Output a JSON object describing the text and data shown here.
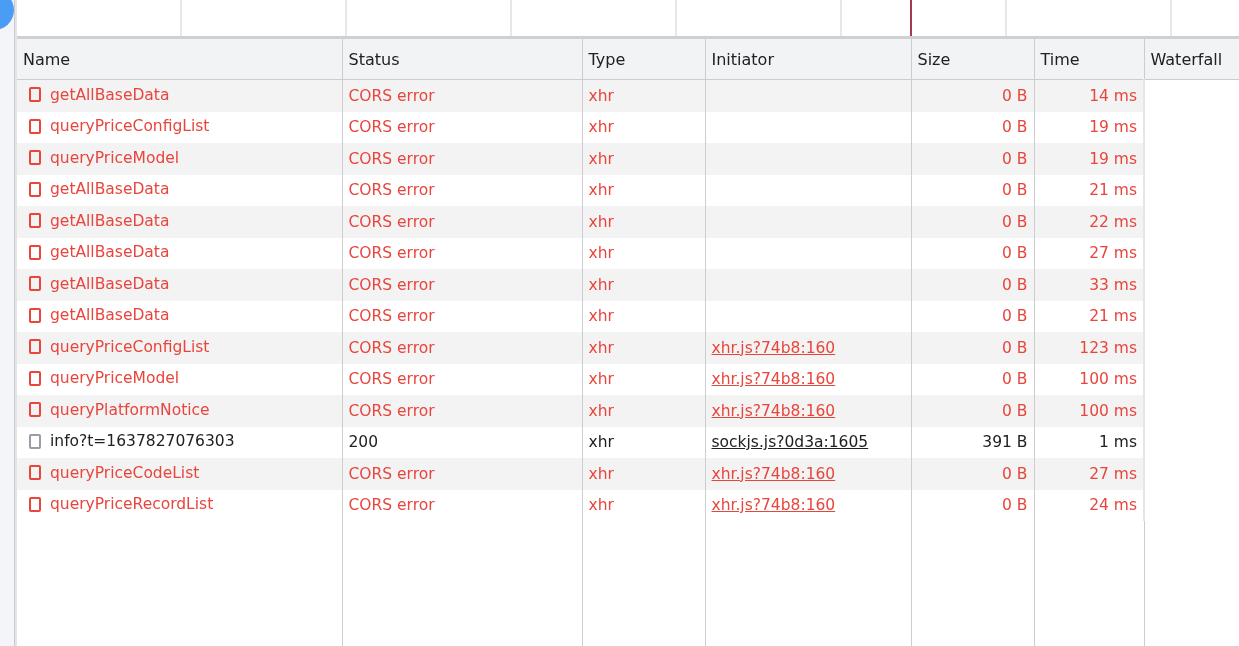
{
  "table": {
    "columns": [
      "Name",
      "Status",
      "Type",
      "Initiator",
      "Size",
      "Time",
      "Waterfall"
    ],
    "rows": [
      {
        "name": "getAllBaseData",
        "status": "CORS error",
        "type": "xhr",
        "initiator": "",
        "size": "0 B",
        "time": "14 ms",
        "error": true
      },
      {
        "name": "queryPriceConfigList",
        "status": "CORS error",
        "type": "xhr",
        "initiator": "",
        "size": "0 B",
        "time": "19 ms",
        "error": true
      },
      {
        "name": "queryPriceModel",
        "status": "CORS error",
        "type": "xhr",
        "initiator": "",
        "size": "0 B",
        "time": "19 ms",
        "error": true
      },
      {
        "name": "getAllBaseData",
        "status": "CORS error",
        "type": "xhr",
        "initiator": "",
        "size": "0 B",
        "time": "21 ms",
        "error": true
      },
      {
        "name": "getAllBaseData",
        "status": "CORS error",
        "type": "xhr",
        "initiator": "",
        "size": "0 B",
        "time": "22 ms",
        "error": true
      },
      {
        "name": "getAllBaseData",
        "status": "CORS error",
        "type": "xhr",
        "initiator": "",
        "size": "0 B",
        "time": "27 ms",
        "error": true
      },
      {
        "name": "getAllBaseData",
        "status": "CORS error",
        "type": "xhr",
        "initiator": "",
        "size": "0 B",
        "time": "33 ms",
        "error": true
      },
      {
        "name": "getAllBaseData",
        "status": "CORS error",
        "type": "xhr",
        "initiator": "",
        "size": "0 B",
        "time": "21 ms",
        "error": true
      },
      {
        "name": "queryPriceConfigList",
        "status": "CORS error",
        "type": "xhr",
        "initiator": "xhr.js?74b8:160",
        "size": "0 B",
        "time": "123 ms",
        "error": true
      },
      {
        "name": "queryPriceModel",
        "status": "CORS error",
        "type": "xhr",
        "initiator": "xhr.js?74b8:160",
        "size": "0 B",
        "time": "100 ms",
        "error": true
      },
      {
        "name": "queryPlatformNotice",
        "status": "CORS error",
        "type": "xhr",
        "initiator": "xhr.js?74b8:160",
        "size": "0 B",
        "time": "100 ms",
        "error": true
      },
      {
        "name": "info?t=1637827076303",
        "status": "200",
        "type": "xhr",
        "initiator": "sockjs.js?0d3a:1605",
        "size": "391 B",
        "time": "1 ms",
        "error": false
      },
      {
        "name": "queryPriceCodeList",
        "status": "CORS error",
        "type": "xhr",
        "initiator": "xhr.js?74b8:160",
        "size": "0 B",
        "time": "27 ms",
        "error": true
      },
      {
        "name": "queryPriceRecordList",
        "status": "CORS error",
        "type": "xhr",
        "initiator": "xhr.js?74b8:160",
        "size": "0 B",
        "time": "24 ms",
        "error": true
      }
    ]
  }
}
